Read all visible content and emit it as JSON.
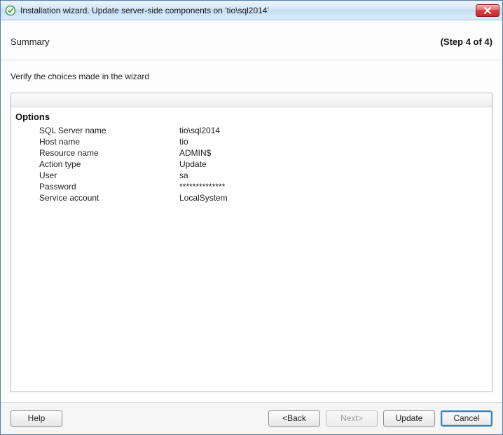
{
  "window": {
    "title": "Installation wizard. Update server-side components on 'tio\\sql2014'"
  },
  "header": {
    "summary": "Summary",
    "step": "(Step 4 of 4)"
  },
  "instruction": "Verify the choices made in the wizard",
  "options": {
    "group_title": "Options",
    "rows": [
      {
        "label": "SQL Server name",
        "value": "tio\\sql2014"
      },
      {
        "label": "Host name",
        "value": "tio"
      },
      {
        "label": "Resource name",
        "value": "ADMIN$"
      },
      {
        "label": "Action type",
        "value": "Update"
      },
      {
        "label": "User",
        "value": "sa"
      },
      {
        "label": "Password",
        "value": "**************"
      },
      {
        "label": "Service account",
        "value": "LocalSystem"
      }
    ]
  },
  "buttons": {
    "help": "Help",
    "back": "<Back",
    "next": "Next>",
    "update": "Update",
    "cancel": "Cancel"
  }
}
